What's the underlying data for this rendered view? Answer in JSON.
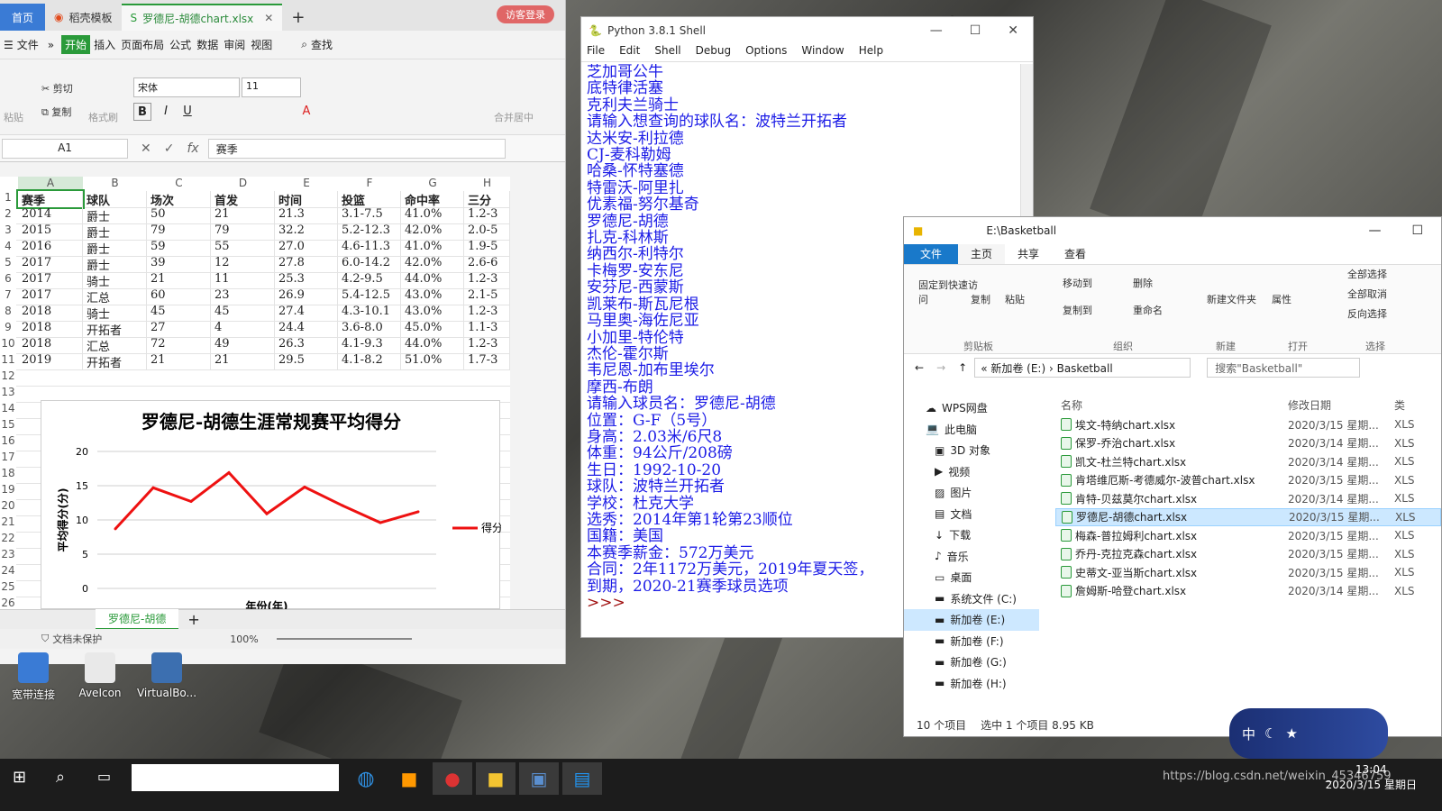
{
  "wps": {
    "tabs": [
      "首页",
      "稻壳模板",
      "罗德尼-胡德chart.xlsx"
    ],
    "visitor": "访客登录",
    "menu": [
      "文件",
      "开始",
      "插入",
      "页面布局",
      "公式",
      "数据",
      "审阅",
      "视图",
      "查找"
    ],
    "ribbon": {
      "paste": "粘贴",
      "cut": "剪切",
      "copy": "复制",
      "format_painter": "格式刷",
      "font": "宋体",
      "size": "11",
      "merge": "合并居中"
    },
    "namebox": "A1",
    "formula_value": "赛季",
    "columns": [
      "A",
      "B",
      "C",
      "D",
      "E",
      "F",
      "G",
      "H"
    ],
    "rows": [
      "1",
      "2",
      "3",
      "4",
      "5",
      "6",
      "7",
      "8",
      "9",
      "10",
      "11",
      "12",
      "13",
      "14",
      "15",
      "16",
      "17",
      "18",
      "19",
      "20",
      "21",
      "22",
      "23",
      "24",
      "25",
      "26"
    ],
    "table": [
      [
        "赛季",
        "球队",
        "场次",
        "首发",
        "时间",
        "投篮",
        "命中率",
        "三分"
      ],
      [
        "2014",
        "爵士",
        "50",
        "21",
        "21.3",
        "3.1-7.5",
        "41.0%",
        "1.2-3"
      ],
      [
        "2015",
        "爵士",
        "79",
        "79",
        "32.2",
        "5.2-12.3",
        "42.0%",
        "2.0-5"
      ],
      [
        "2016",
        "爵士",
        "59",
        "55",
        "27.0",
        "4.6-11.3",
        "41.0%",
        "1.9-5"
      ],
      [
        "2017",
        "爵士",
        "39",
        "12",
        "27.8",
        "6.0-14.2",
        "42.0%",
        "2.6-6"
      ],
      [
        "2017",
        "骑士",
        "21",
        "11",
        "25.3",
        "4.2-9.5",
        "44.0%",
        "1.2-3"
      ],
      [
        "2017",
        "汇总",
        "60",
        "23",
        "26.9",
        "5.4-12.5",
        "43.0%",
        "2.1-5"
      ],
      [
        "2018",
        "骑士",
        "45",
        "45",
        "27.4",
        "4.3-10.1",
        "43.0%",
        "1.2-3"
      ],
      [
        "2018",
        "开拓者",
        "27",
        "4",
        "24.4",
        "3.6-8.0",
        "45.0%",
        "1.1-3"
      ],
      [
        "2018",
        "汇总",
        "72",
        "49",
        "26.3",
        "4.1-9.3",
        "44.0%",
        "1.2-3"
      ],
      [
        "2019",
        "开拓者",
        "21",
        "21",
        "29.5",
        "4.1-8.2",
        "51.0%",
        "1.7-3"
      ]
    ],
    "sheet_tab": "罗德尼-胡德",
    "status_protect": "文档未保护",
    "zoom": "100%"
  },
  "chart_data": {
    "type": "line",
    "title": "罗德尼-胡德生涯常规赛平均得分",
    "ylabel": "平均得分(分)",
    "xlabel": "年份(年)",
    "ylim": [
      0,
      20
    ],
    "yticks": [
      "0",
      "5",
      "10",
      "15",
      "20"
    ],
    "series": [
      {
        "name": "得分",
        "color": "#ee1111",
        "values": [
          8.7,
          14.7,
          12.7,
          16.9,
          10.9,
          14.8,
          12.1,
          9.6,
          11.2
        ]
      }
    ]
  },
  "python": {
    "title": "Python 3.8.1 Shell",
    "menu": [
      "File",
      "Edit",
      "Shell",
      "Debug",
      "Options",
      "Window",
      "Help"
    ],
    "lines": [
      "芝加哥公牛",
      "底特律活塞",
      "克利夫兰骑士",
      "请输入想查询的球队名：波特兰开拓者",
      "达米安-利拉德",
      "CJ-麦科勒姆",
      "哈桑-怀特塞德",
      "特雷沃-阿里扎",
      "优素福-努尔基奇",
      "罗德尼-胡德",
      "扎克-科林斯",
      "纳西尔-利特尔",
      "卡梅罗-安东尼",
      "安芬尼-西蒙斯",
      "凯莱布-斯瓦尼根",
      "马里奥-海佐尼亚",
      "小加里-特伦特",
      "杰伦-霍尔斯",
      "韦尼恩-加布里埃尔",
      "摩西-布朗",
      "请输入球员名：罗德尼-胡德",
      "位置：G-F（5号）",
      "身高：2.03米/6尺8",
      "体重：94公斤/208磅",
      "生日：1992-10-20",
      "球队：波特兰开拓者",
      "学校：杜克大学",
      "选秀：2014年第1轮第23顺位",
      "国籍：美国",
      "本赛季薪金：572万美元",
      "合同：2年1172万美元，2019年夏天签，",
      "到期，2020-21赛季球员选项"
    ],
    "prompt": ">>>"
  },
  "explorer": {
    "path_title": "E:\\Basketball",
    "tabs": [
      "文件",
      "主页",
      "共享",
      "查看"
    ],
    "ribbon_groups": [
      "剪贴板",
      "组织",
      "新建",
      "打开",
      "选择"
    ],
    "ribbon_items": [
      "固定到快速访问",
      "复制",
      "粘贴",
      "移动到",
      "复制到",
      "删除",
      "重命名",
      "新建文件夹",
      "属性",
      "全部选择",
      "全部取消",
      "反向选择"
    ],
    "breadcrumb": [
      "新加卷 (E:)",
      "Basketball"
    ],
    "search_placeholder": "搜索\"Basketball\"",
    "nav": [
      "WPS网盘",
      "此电脑",
      "3D 对象",
      "视频",
      "图片",
      "文档",
      "下载",
      "音乐",
      "桌面",
      "系统文件 (C:)",
      "新加卷 (E:)",
      "新加卷 (F:)",
      "新加卷 (G:)",
      "新加卷 (H:)"
    ],
    "headers": [
      "名称",
      "修改日期",
      "类"
    ],
    "files": [
      {
        "name": "埃文-特纳chart.xlsx",
        "date": "2020/3/15 星期..."
      },
      {
        "name": "保罗-乔治chart.xlsx",
        "date": "2020/3/14 星期..."
      },
      {
        "name": "凯文-杜兰特chart.xlsx",
        "date": "2020/3/14 星期..."
      },
      {
        "name": "肯塔维厄斯-考德威尔-波普chart.xlsx",
        "date": "2020/3/15 星期..."
      },
      {
        "name": "肯特-贝兹莫尔chart.xlsx",
        "date": "2020/3/14 星期..."
      },
      {
        "name": "罗德尼-胡德chart.xlsx",
        "date": "2020/3/15 星期..."
      },
      {
        "name": "梅森-普拉姆利chart.xlsx",
        "date": "2020/3/15 星期..."
      },
      {
        "name": "乔丹-克拉克森chart.xlsx",
        "date": "2020/3/15 星期..."
      },
      {
        "name": "史蒂文-亚当斯chart.xlsx",
        "date": "2020/3/15 星期..."
      },
      {
        "name": "詹姆斯-哈登chart.xlsx",
        "date": "2020/3/14 星期..."
      }
    ],
    "file_type": "XLS",
    "status_count": "10 个项目",
    "status_sel": "选中 1 个项目  8.95 KB"
  },
  "desktop_icons": [
    "宽带连接",
    "AveIcon",
    "VirtualBo..."
  ],
  "taskbar": {
    "time": "13:04",
    "date": "2020/3/15 星期日",
    "tray_text": "https://blog.csdn.net/weixin_45346759",
    "ime": "中"
  }
}
